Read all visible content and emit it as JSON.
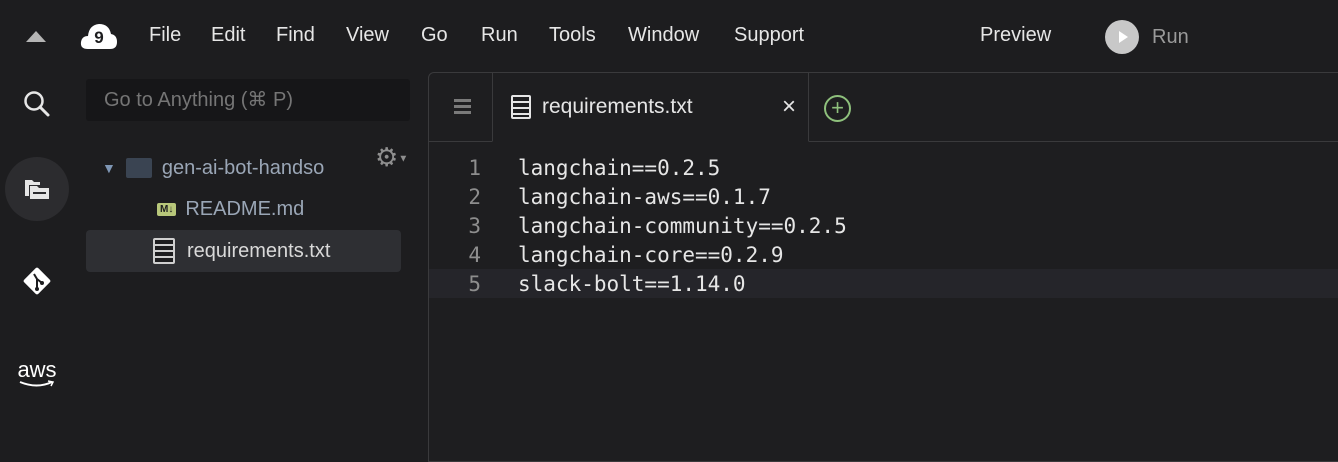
{
  "menubar": {
    "items": [
      "File",
      "Edit",
      "Find",
      "View",
      "Go",
      "Run",
      "Tools",
      "Window",
      "Support"
    ],
    "preview": "Preview",
    "run": "Run"
  },
  "sidebar": {
    "goto_placeholder": "Go to Anything (⌘ P)",
    "aws_label": "aws",
    "folder": "gen-ai-bot-handso",
    "files": [
      {
        "name": "README.md",
        "badge": "M↓"
      },
      {
        "name": "requirements.txt"
      }
    ]
  },
  "editor": {
    "tab": "requirements.txt",
    "lines": [
      {
        "n": "1",
        "text": "langchain==0.2.5"
      },
      {
        "n": "2",
        "text": "langchain-aws==0.1.7"
      },
      {
        "n": "3",
        "text": "langchain-community==0.2.5"
      },
      {
        "n": "4",
        "text": "langchain-core==0.2.9"
      },
      {
        "n": "5",
        "text": "slack-bolt==1.14.0"
      }
    ]
  },
  "colors": {
    "accent_green": "#8ec07c",
    "md_badge": "#b8c77a"
  }
}
